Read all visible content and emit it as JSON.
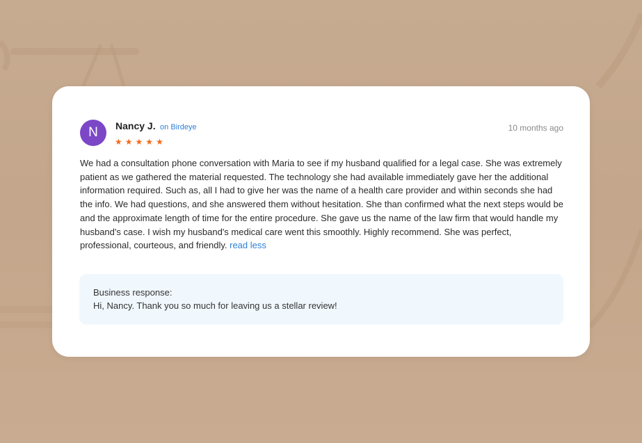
{
  "review": {
    "avatar_initial": "N",
    "reviewer_name": "Nancy J.",
    "source_label": "on Birdeye",
    "rating": 5,
    "stars": [
      "★",
      "★",
      "★",
      "★",
      "★"
    ],
    "timestamp": "10 months ago",
    "text": "We had a consultation phone conversation with Maria to see if my husband qualified for a legal case. She was extremely patient as we gathered the material requested. The technology she had available immediately gave her the additional information required. Such as, all I had to give her was the name of a health care provider and within seconds she had the info. We had questions, and she answered them without hesitation. She than confirmed what the next steps would be and the approximate length of time for the entire procedure. She gave us the name of the law firm that would handle my husband's case. I wish my husband's medical care went this smoothly. Highly recommend. She was perfect, professional, courteous, and friendly.",
    "toggle_label": "read less"
  },
  "business_response": {
    "label": "Business response:",
    "text": "Hi, Nancy. Thank you so much for leaving us a stellar review!"
  },
  "colors": {
    "avatar": "#7b47c6",
    "star": "#f26b1d",
    "link": "#2f7fd8",
    "response_bg": "#f1f8fd",
    "background": "#c5a88e"
  }
}
